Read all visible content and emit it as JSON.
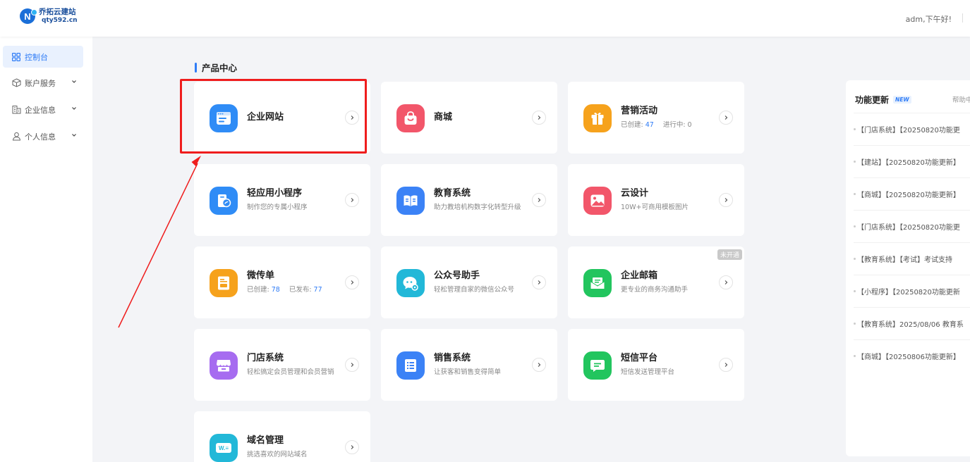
{
  "header": {
    "logo_name": "乔拓云建站",
    "logo_domain": "qty592.cn",
    "greeting": "adm,下午好!"
  },
  "sidebar": {
    "items": [
      {
        "label": "控制台",
        "icon": "dashboard-grid-icon",
        "active": true
      },
      {
        "label": "账户服务",
        "icon": "box-icon",
        "expandable": true
      },
      {
        "label": "企业信息",
        "icon": "building-icon",
        "expandable": true
      },
      {
        "label": "个人信息",
        "icon": "user-icon",
        "expandable": true
      }
    ]
  },
  "main": {
    "section_title": "产品中心",
    "cards": [
      {
        "title": "企业网站",
        "icon": "website-icon",
        "color": "#2f8cf6"
      },
      {
        "title": "商城",
        "icon": "shopping-bag-icon",
        "color": "#f2566a"
      },
      {
        "title": "营销活动",
        "icon": "gift-icon",
        "color": "#f6a21c",
        "created_label": "已创建:",
        "created": "47",
        "ongoing_label": "进行中:",
        "ongoing": "0"
      },
      {
        "title": "轻应用小程序",
        "subtitle": "制作您的专属小程序",
        "icon": "mini-program-icon",
        "color": "#2f8cf6"
      },
      {
        "title": "教育系统",
        "subtitle": "助力教培机构数字化转型升级",
        "icon": "book-icon",
        "color": "#3b82f6"
      },
      {
        "title": "云设计",
        "subtitle": "10W+可商用模板图片",
        "icon": "image-icon",
        "color": "#f2566a"
      },
      {
        "title": "微传单",
        "icon": "flyer-icon",
        "color": "#f6a21c",
        "created_label": "已创建:",
        "created": "78",
        "published_label": "已发布:",
        "published": "77"
      },
      {
        "title": "公众号助手",
        "subtitle": "轻松管理自家的微信公众号",
        "icon": "chat-gear-icon",
        "color": "#22b8d8"
      },
      {
        "title": "企业邮箱",
        "subtitle": "更专业的商务沟通助手",
        "icon": "mail-icon",
        "color": "#22c55e",
        "badge": "未开通"
      },
      {
        "title": "门店系统",
        "subtitle": "轻松搞定会员管理和会员营销",
        "icon": "store-icon",
        "color": "#a66cf0"
      },
      {
        "title": "销售系统",
        "subtitle": "让获客和销售变得简单",
        "icon": "list-icon",
        "color": "#3b82f6"
      },
      {
        "title": "短信平台",
        "subtitle": "短信发送管理平台",
        "icon": "sms-icon",
        "color": "#22c55e"
      },
      {
        "title": "域名管理",
        "subtitle": "挑选喜欢的网站域名",
        "icon": "domain-icon",
        "color": "#22b8d8"
      }
    ]
  },
  "updates": {
    "title": "功能更新",
    "new_badge": "NEW",
    "help": "帮助中",
    "items": [
      "【门店系统】【20250820功能更",
      "【建站】【20250820功能更新】",
      "【商城】【20250820功能更新】",
      "【门店系统】【20250820功能更",
      "【教育系统】【考试】考试支持",
      "【小程序】【20250820功能更新",
      "【教育系统】2025/08/06 教育系",
      "【商城】【20250806功能更新】"
    ]
  },
  "colors": {
    "accent": "#2f7cf6",
    "annotation": "#ef1d1d"
  }
}
